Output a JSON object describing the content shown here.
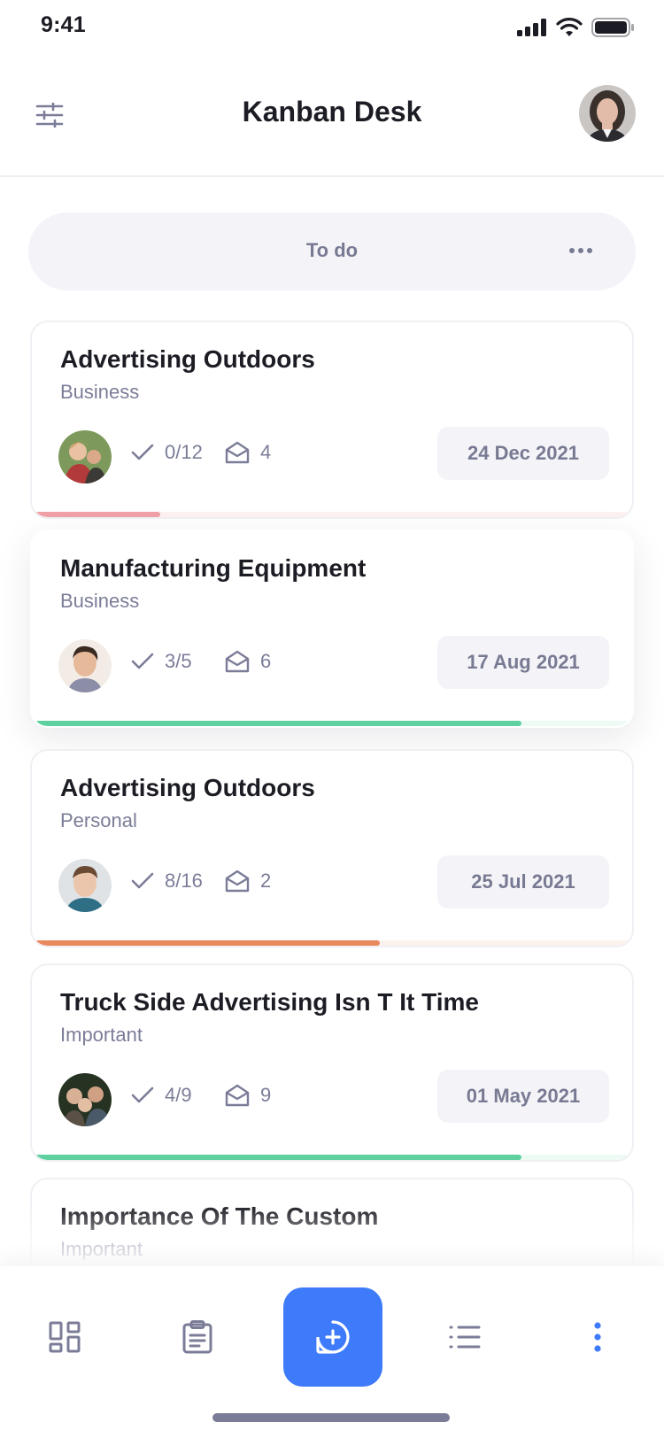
{
  "status_bar": {
    "time": "9:41"
  },
  "header": {
    "title": "Kanban Desk",
    "filter_icon": "sliders-icon",
    "profile_avatar": "woman-portrait-avatar"
  },
  "column": {
    "title": "To do",
    "more_icon": "more-horizontal-icon"
  },
  "cards": [
    {
      "title": "Advertising Outdoors",
      "category": "Business",
      "tasks": "0/12",
      "messages": "4",
      "date": "24 Dec 2021",
      "progress": 0.21,
      "progress_color": "#f2a0a8",
      "track_color": "#fdf1f2",
      "avatar": "couple-with-child-avatar"
    },
    {
      "title": "Manufacturing Equipment",
      "category": "Business",
      "tasks": "3/5",
      "messages": "6",
      "date": "17 Aug 2021",
      "progress": 0.82,
      "progress_color": "#5fd1a0",
      "track_color": "#eefbf5",
      "avatar": "young-man-avatar"
    },
    {
      "title": "Advertising Outdoors",
      "category": "Personal",
      "tasks": "8/16",
      "messages": "2",
      "date": "25 Jul 2021",
      "progress": 0.58,
      "progress_color": "#e9875d",
      "track_color": "#fdf1ed",
      "avatar": "man-portrait-avatar"
    },
    {
      "title": "Truck Side Advertising Isn T It Time",
      "category": "Important",
      "tasks": "4/9",
      "messages": "9",
      "date": "01 May 2021",
      "progress": 0.82,
      "progress_color": "#5fd1a0",
      "track_color": "#eefbf5",
      "avatar": "group-family-avatar"
    },
    {
      "title": "Importance Of The Custom",
      "category": "Important"
    }
  ],
  "bottom_nav": {
    "items": [
      "dashboard-icon",
      "clipboard-icon",
      "add-circle-icon",
      "list-icon",
      "more-vertical-icon"
    ],
    "accent": "#3e7bfa"
  }
}
